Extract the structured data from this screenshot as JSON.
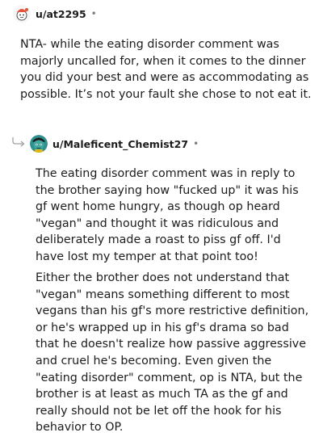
{
  "top_comment": {
    "username": "u/at2295",
    "separator": "•",
    "body": "NTA- while the eating disorder comment was majorly uncalled for, when it comes to the dinner you did your best and were as accommodating as possible. It’s not your fault she chose to not eat it."
  },
  "reply_comment": {
    "username": "u/Maleficent_Chemist27",
    "separator": "•",
    "paragraphs": [
      "The eating disorder comment was in reply to the brother saying how \"fucked up\" it was his gf went home hungry, as though op heard \"vegan\" and thought it was ridiculous and deliberately made a roast to piss gf off. I'd have lost my temper at that point too!",
      "Either the brother does not understand that \"vegan\" means something different to most vegans than his gf's more restrictive definition, or he's wrapped up in his gf's drama so bad that he doesn't realize how passive aggressive and cruel he's becoming. Even given the \"eating disorder\" comment, op is NTA, but the brother is at least as much TA as the gf and really should not be let off the hook for his behavior to OP."
    ]
  },
  "colors": {
    "text": "#1c1c1c",
    "meta": "#7c7c7c",
    "avatar1_bg": "#ff4500",
    "avatar2_bg": "#1f7a8c"
  }
}
